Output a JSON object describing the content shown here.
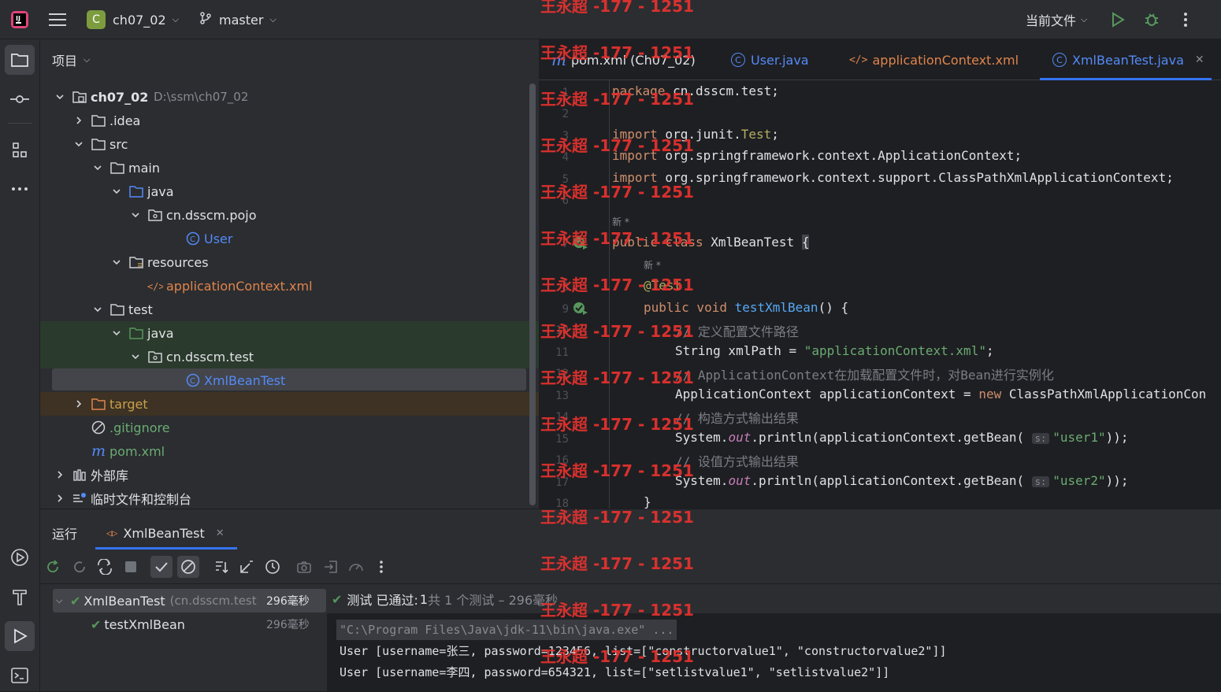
{
  "titlebar": {
    "project_badge": "C",
    "project_name": "ch07_02",
    "branch": "master",
    "run_config": "当前文件",
    "colors": {
      "badge": "#7d9c3e",
      "run": "#57965c"
    }
  },
  "project_panel": {
    "title": "项目",
    "tree": [
      {
        "label": "ch07_02",
        "hint": "D:\\ssm\\ch07_02",
        "icon": "module-folder-icon",
        "expanded": true
      },
      {
        "label": ".idea",
        "icon": "folder-icon",
        "expanded": false
      },
      {
        "label": "src",
        "icon": "folder-icon",
        "expanded": true
      },
      {
        "label": "main",
        "icon": "folder-icon",
        "expanded": true
      },
      {
        "label": "java",
        "icon": "source-folder-icon",
        "expanded": true
      },
      {
        "label": "cn.dsscm.pojo",
        "icon": "package-icon",
        "expanded": true
      },
      {
        "label": "User",
        "icon": "class-icon"
      },
      {
        "label": "resources",
        "icon": "resources-folder-icon",
        "expanded": true
      },
      {
        "label": "applicationContext.xml",
        "icon": "xml-icon"
      },
      {
        "label": "test",
        "icon": "folder-icon",
        "expanded": true
      },
      {
        "label": "java",
        "icon": "test-folder-icon",
        "expanded": true
      },
      {
        "label": "cn.dsscm.test",
        "icon": "package-icon",
        "expanded": true
      },
      {
        "label": "XmlBeanTest",
        "icon": "class-icon",
        "selected": true
      },
      {
        "label": "target",
        "icon": "excluded-folder-icon",
        "expanded": false
      },
      {
        "label": ".gitignore",
        "icon": "ignore-icon"
      },
      {
        "label": "pom.xml",
        "icon": "maven-icon"
      },
      {
        "label": "外部库",
        "icon": "library-icon",
        "expanded": false
      },
      {
        "label": "临时文件和控制台",
        "icon": "scratch-icon",
        "expanded": false
      }
    ]
  },
  "editor": {
    "tabs": [
      {
        "label": "pom.xml (Ch07_02)",
        "icon": "maven-icon"
      },
      {
        "label": "User.java",
        "icon": "class-icon"
      },
      {
        "label": "applicationContext.xml",
        "icon": "xml-icon"
      },
      {
        "label": "XmlBeanTest.java",
        "icon": "class-icon",
        "active": true
      }
    ],
    "line_numbers": [
      "1",
      "2",
      "3",
      "4",
      "5",
      "6",
      "7",
      "8",
      "9",
      "10",
      "11",
      "12",
      "13",
      "14",
      "15",
      "16",
      "17",
      "18"
    ],
    "author_hint": "新 *",
    "lines": {
      "l1_kw": "package",
      "l1_rest": " cn.dsscm.test;",
      "l3_kw": "import",
      "l3_rest": " org.junit.",
      "l3_cls": "Test",
      "l3_end": ";",
      "l4_kw": "import",
      "l4_rest": " org.springframework.context.ApplicationContext;",
      "l5_kw": "import",
      "l5_rest": " org.springframework.context.support.ClassPathXmlApplicationContext;",
      "l7_kw": "public class",
      "l7_rest": " XmlBeanTest ",
      "l7_brace": "{",
      "l8": "@Test",
      "l9_kw": "public void",
      "l9_fn": " testXmlBean",
      "l9_rest": "() {",
      "l10": "// 定义配置文件路径",
      "l11_a": "String xmlPath = ",
      "l11_str": "\"applicationContext.xml\"",
      "l11_end": ";",
      "l12": "// ApplicationContext在加载配置文件时，对Bean进行实例化",
      "l13_a": "ApplicationContext applicationContext = ",
      "l13_kw": "new",
      "l13_rest": " ClassPathXmlApplicationCon",
      "l14": "// 构造方式输出结果",
      "l15_a": "System.",
      "l15_fld": "out",
      "l15_b": ".println(applicationContext.getBean( ",
      "l15_hint": "s:",
      "l15_str": "\"user1\"",
      "l15_end": "));",
      "l16": "// 设值方式输出结果",
      "l17_a": "System.",
      "l17_fld": "out",
      "l17_b": ".println(applicationContext.getBean( ",
      "l17_hint": "s:",
      "l17_str": "\"user2\"",
      "l17_end": "));",
      "l18": "}"
    }
  },
  "run_panel": {
    "title": "运行",
    "tab_label": "XmlBeanTest",
    "tests": [
      {
        "name": "XmlBeanTest",
        "hint": "(cn.dsscm.test",
        "time": "296毫秒",
        "passed": true
      },
      {
        "name": "testXmlBean",
        "time": "296毫秒",
        "passed": true
      }
    ],
    "status_pass": "测试 已通过:",
    "status_count": "1",
    "status_rest": "共 1 个测试 – 296毫秒",
    "console": [
      "\"C:\\Program Files\\Java\\jdk-11\\bin\\java.exe\" ...",
      "User [username=张三, password=123456, list=[\"constructorvalue1\", \"constructorvalue2\"]]",
      "User [username=李四, password=654321, list=[\"setlistvalue1\", \"setlistvalue2\"]]"
    ]
  },
  "watermark": "王永超 -177 - 1251"
}
